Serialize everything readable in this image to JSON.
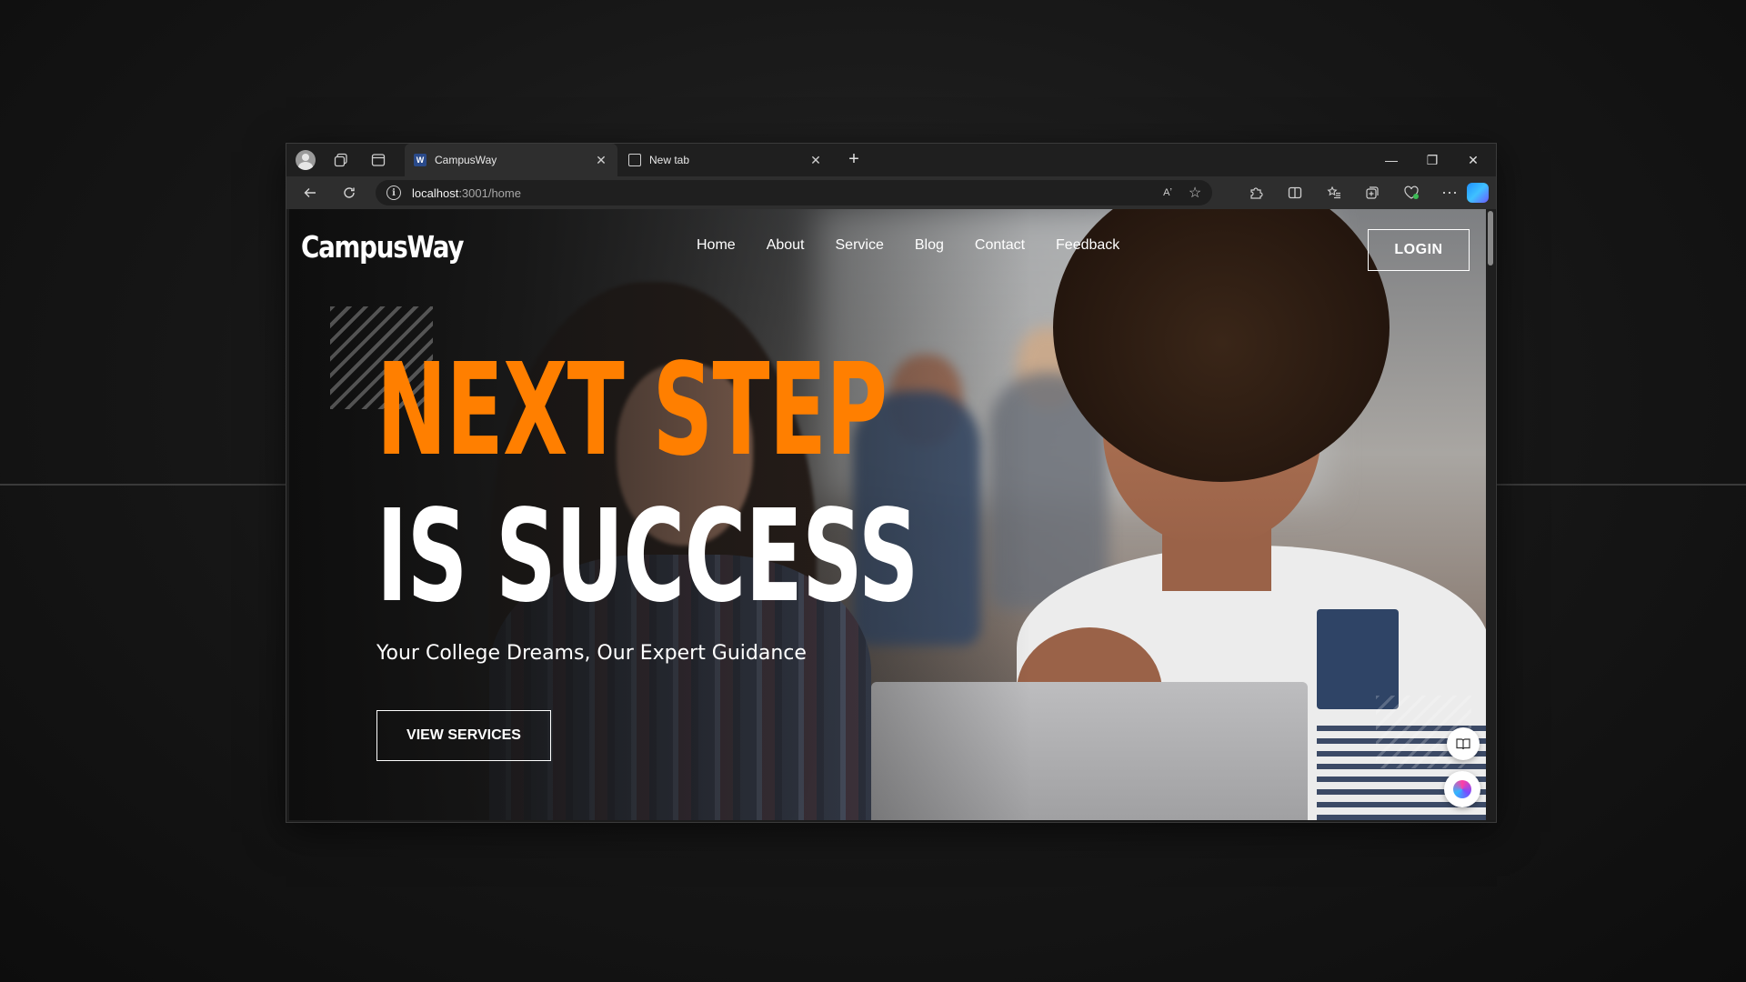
{
  "browser": {
    "tabs": [
      {
        "title": "CampusWay",
        "favicon": "campusway-favicon",
        "active": true
      },
      {
        "title": "New tab",
        "favicon": "new-tab-icon",
        "active": false
      }
    ],
    "new_tab_symbol": "+",
    "tab_close_symbol": "✕",
    "address": {
      "host": "localhost",
      "path": ":3001/home"
    },
    "info_symbol": "i",
    "read_aloud_symbol": "Aʼ",
    "window_controls": {
      "minimize": "—",
      "restore": "❐",
      "close": "✕"
    },
    "accent_copilot": "#1e90ff"
  },
  "site": {
    "logo": "CampusWay",
    "nav": [
      "Home",
      "About",
      "Service",
      "Blog",
      "Contact",
      "Feedback"
    ],
    "login_label": "LOGIN",
    "headline_line1": "NEXT STEP",
    "headline_line2": "IS SUCCESS",
    "tagline": "Your College Dreams, Our Expert Guidance",
    "cta_label": "VIEW SERVICES",
    "colors": {
      "accent": "#ff7f00",
      "text": "#ffffff"
    }
  }
}
